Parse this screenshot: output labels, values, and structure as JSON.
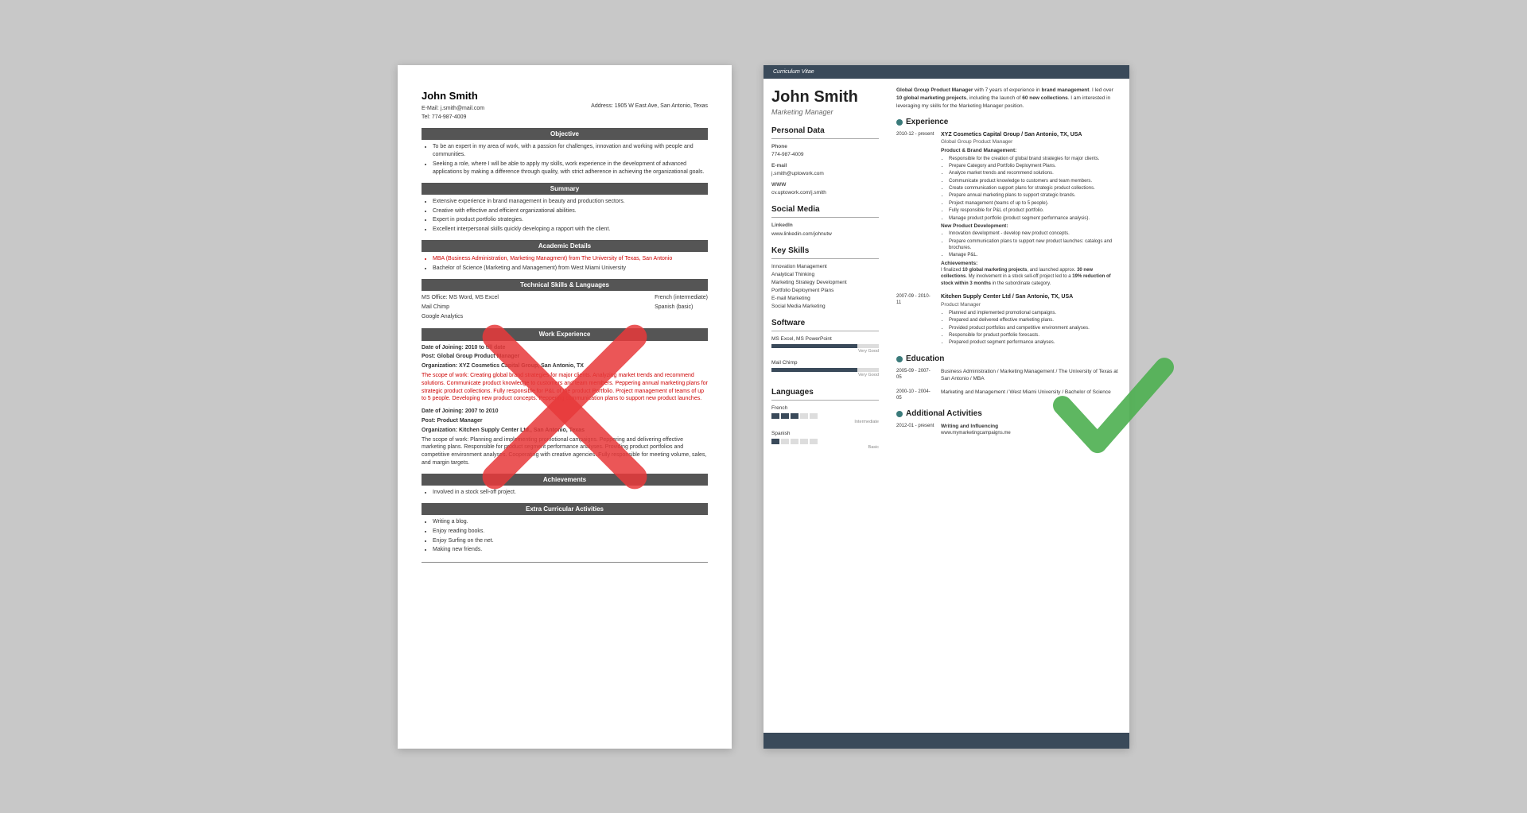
{
  "left_resume": {
    "name": "John Smith",
    "email": "E-Mail: j.smith@mail.com",
    "tel": "Tel: 774-987-4009",
    "address": "Address: 1905 W East Ave, San Antonio, Texas",
    "sections": {
      "objective": {
        "header": "Objective",
        "bullets": [
          "To be an expert in my area of work, with a passion for challenges, innovation and working with people and communities.",
          "Seeking a role, where I will be able to apply my skills, work experience in the development of advanced applications by making a difference through quality, with strict adherence in achieving the organizational goals."
        ]
      },
      "summary": {
        "header": "Summary",
        "bullets": [
          "Extensive experience in brand management in beauty and production sectors.",
          "Creative with effective and efficient organizational abilities.",
          "Expert in product portfolio strategies.",
          "Excellent interpersonal skills quickly developing a rapport with the client."
        ]
      },
      "academic": {
        "header": "Academic Details",
        "bullets": [
          "MBA (Business Administration, Marketing Managment) from The University of Texas, San Antonio",
          "Bachelor of Science (Marketing and Management) from West Miami University"
        ]
      },
      "technical": {
        "header": "Technical Skills & Languages",
        "items": [
          "MS Office: MS Word, MS Excel",
          "Mail Chimp",
          "Google Analytics",
          "French (intermediate)",
          "Spanish (basic)"
        ]
      },
      "work": {
        "header": "Work Experience",
        "entry1": {
          "joining": "Date of Joining: 2010 to till date",
          "post": "Post: Global Group Product Manager",
          "org": "Organization: XYZ Cosmetics Capital Group, San Antonio, TX",
          "scope": "The scope of work: Creating global brand strategies for major clients. Analyzing market trends and recommend solutions. Communicate product knowledge to customers and team members. Peppering annual marketing plans for strategic product collections. Fully responsible for P&L of the product Portfolio. Project management of teams of up to 5 people. Developing new product concepts. Peppering communication plans to support new product launches."
        },
        "entry2": {
          "joining": "Date of Joining: 2007 to 2010",
          "post": "Post: Product Manager",
          "org": "Organization: Kitchen Supply Center Ltd., San Antonio, Texas",
          "scope": "The scope of work: Planning and implementing promotional campaigns. Peppering and delivering effective marketing plans. Responsible for product segment performance analyses. Providing product portfolios and competitive environment analyses. Cooperating with creative agencies. Fully responsible for meeting volume, sales, and margin targets."
        }
      },
      "achievements": {
        "header": "Achievements",
        "bullets": [
          "Involved in a stock sell-off project."
        ]
      },
      "extra": {
        "header": "Extra Curricular Activities",
        "bullets": [
          "Writing a blog.",
          "Enjoy reading books.",
          "Enjoy Surfing on the net.",
          "Making new friends."
        ]
      }
    }
  },
  "right_resume": {
    "cv_label": "Curriculum Vitae",
    "name": "John Smith",
    "job_title": "Marketing Manager",
    "personal_data": {
      "section_title": "Personal Data",
      "phone_label": "Phone",
      "phone": "774-987-4009",
      "email_label": "E-mail",
      "email": "j.smith@uptowork.com",
      "www_label": "WWW",
      "www": "cv.uptowork.com/j.smith"
    },
    "social_media": {
      "section_title": "Social Media",
      "linkedin_label": "LinkedIn",
      "linkedin": "www.linkedin.com/johnutw"
    },
    "key_skills": {
      "section_title": "Key Skills",
      "items": [
        "Innovation Management",
        "Analytical Thinking",
        "Marketing Strategy Development",
        "Portfolio Deployment Plans",
        "E-mail Marketing",
        "Social Media Marketing"
      ]
    },
    "software": {
      "section_title": "Software",
      "items": [
        {
          "name": "MS Excel, MS PowerPoint",
          "level": 4,
          "max": 5,
          "label": "Very Good"
        },
        {
          "name": "Mail Chimp",
          "level": 4,
          "max": 5,
          "label": "Very Good"
        }
      ]
    },
    "languages": {
      "section_title": "Languages",
      "items": [
        {
          "name": "French",
          "level": 3,
          "max": 5,
          "label": "Intermediate"
        },
        {
          "name": "Spanish",
          "level": 1,
          "max": 5,
          "label": "Basic"
        }
      ]
    },
    "intro": "Global Group Product Manager with 7 years of experience in brand management. I led over 10 global marketing projects, including the launch of 60 new collections. I am interested in leveraging my skills for the Marketing Manager position.",
    "experience": {
      "section_title": "Experience",
      "entries": [
        {
          "dates": "2010-12 - present",
          "company": "XYZ Cosmetics Capital Group / San Antonio, TX, USA",
          "role": "Global Group Product Manager",
          "sub_sections": [
            {
              "title": "Product & Brand Management:",
              "bullets": [
                "Responsible for the creation of global brand strategies for major clients.",
                "Prepare Category and Portfolio Deployment Plans.",
                "Analyze market trends and recommend solutions.",
                "Communicate product knowledge to customers and team members.",
                "Create communication support plans for strategic product collections.",
                "Prepare annual marketing plans to support strategic brands.",
                "Project management (teams of up to 5 people).",
                "Fully responsible for P&L of product portfolio.",
                "Manage product portfolio (product segment performance analysis)."
              ]
            },
            {
              "title": "New Product Development:",
              "bullets": [
                "Innovation development - develop new product concepts.",
                "Prepare communication plans to support new product launches: catalogs and brochures.",
                "Manage P&L."
              ]
            },
            {
              "title": "Achievements:",
              "text": "I finalized 10 global marketing projects, and launched approx. 30 new collections. My involvement in a stock sell-off project led to a 19% reduction of stock within 3 months in the subordinate category."
            }
          ]
        },
        {
          "dates": "2007-09 - 2010-11",
          "company": "Kitchen Supply Center Ltd / San Antonio, TX, USA",
          "role": "Product Manager",
          "bullets": [
            "Planned and implemented promotional campaigns.",
            "Prepared and delivered effective marketing plans.",
            "Provided product portfolios and competitive environment analyses.",
            "Responsible for product portfolio forecasts.",
            "Prepared product segment performance analyses."
          ]
        }
      ]
    },
    "education": {
      "section_title": "Education",
      "entries": [
        {
          "dates": "2005-09 - 2007-05",
          "detail": "Business Administration / Marketing Management / The University of Texas at San Antonio / MBA"
        },
        {
          "dates": "2000-10 - 2004-05",
          "detail": "Marketing and Management / West Miami University / Bachelor of Science"
        }
      ]
    },
    "additional": {
      "section_title": "Additional Activities",
      "entries": [
        {
          "dates": "2012-01 - present",
          "title": "Writing and Influencing",
          "detail": "www.mymarketingcampaigns.me"
        }
      ]
    }
  }
}
